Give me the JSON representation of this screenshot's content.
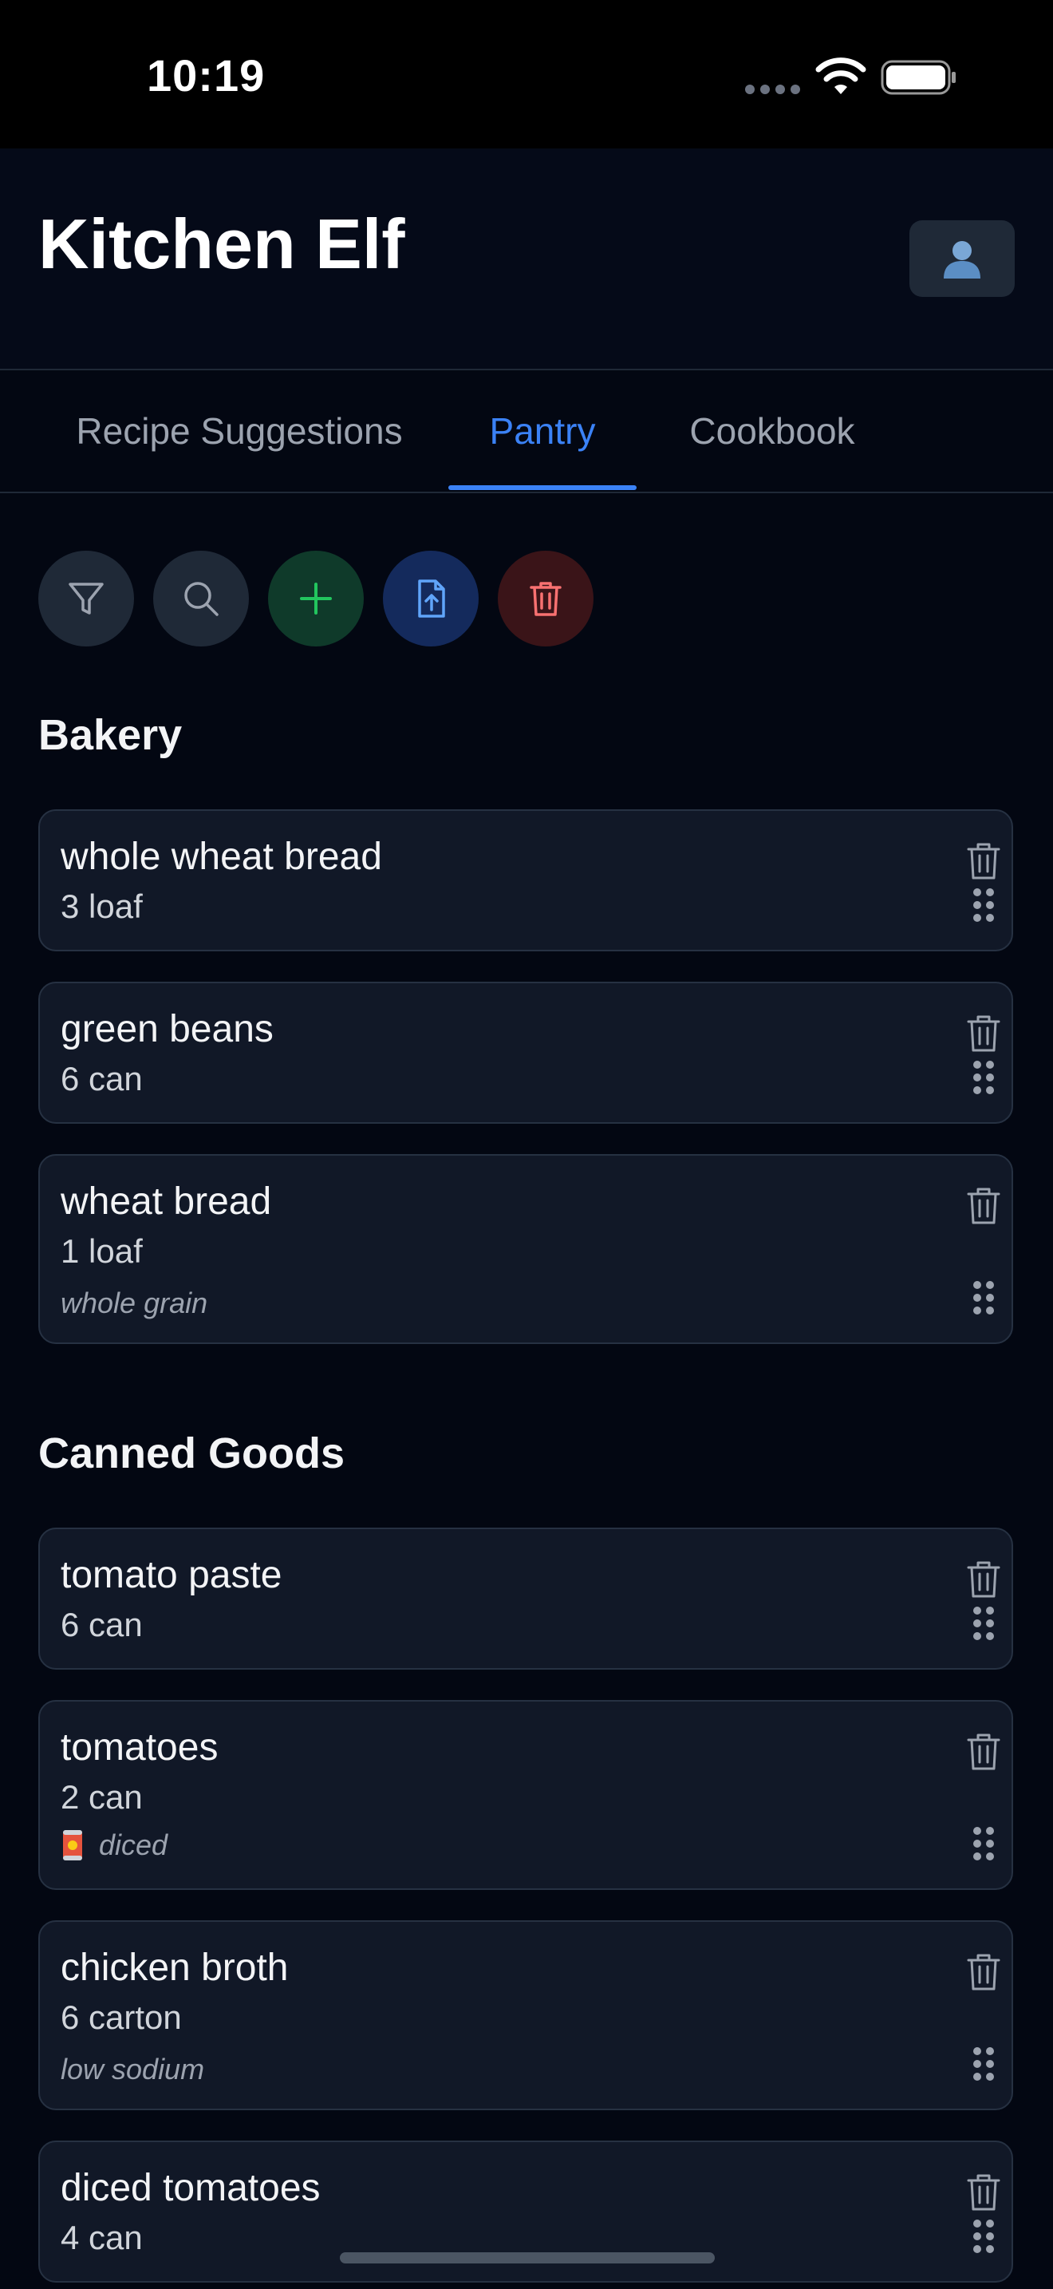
{
  "status_bar": {
    "time": "10:19"
  },
  "header": {
    "title": "Kitchen Elf",
    "profile_icon": "person-icon"
  },
  "tabs": [
    {
      "label": "Recipe Suggestions",
      "active": false
    },
    {
      "label": "Pantry",
      "active": true
    },
    {
      "label": "Cookbook",
      "active": false
    }
  ],
  "toolbar": {
    "buttons": [
      {
        "icon": "filter-icon"
      },
      {
        "icon": "search-icon"
      },
      {
        "icon": "plus-icon"
      },
      {
        "icon": "file-upload-icon"
      },
      {
        "icon": "trash-icon"
      }
    ]
  },
  "sections": [
    {
      "title": "Bakery",
      "items": [
        {
          "name": "whole wheat bread",
          "quantity": "3 loaf"
        },
        {
          "name": "green beans",
          "quantity": "6 can"
        },
        {
          "name": "wheat bread",
          "quantity": "1 loaf",
          "note": "whole grain"
        }
      ]
    },
    {
      "title": "Canned Goods",
      "items": [
        {
          "name": "tomato paste",
          "quantity": "6 can"
        },
        {
          "name": "tomatoes",
          "quantity": "2 can",
          "note": "diced",
          "note_icon": "can-icon"
        },
        {
          "name": "chicken broth",
          "quantity": "6 carton",
          "note": "low sodium"
        },
        {
          "name": "diced tomatoes",
          "quantity": "4 can"
        }
      ]
    }
  ],
  "colors": {
    "background": "#030712",
    "card": "#111827",
    "accent": "#3b82f6",
    "add": "#22c55e",
    "delete": "#f87171"
  }
}
